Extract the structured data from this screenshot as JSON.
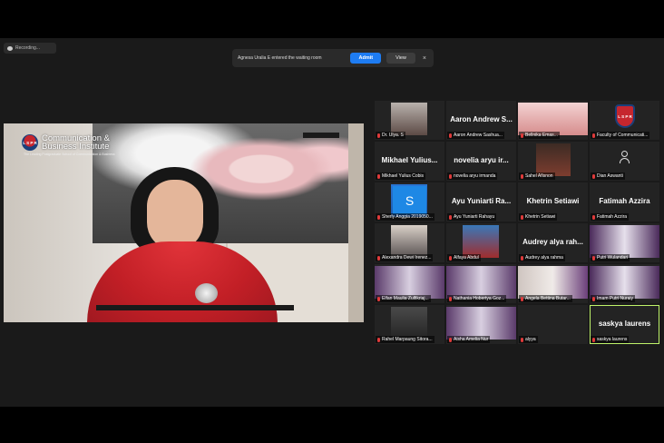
{
  "recording": {
    "label": "Recording..."
  },
  "notification": {
    "message": "Agnesa Uralia E entered the waiting room",
    "admit_label": "Admit",
    "view_label": "View",
    "close_glyph": "×"
  },
  "main_video": {
    "logo_badge": "L S P R",
    "logo_line1": "Communication &",
    "logo_line2": "Business Institute",
    "logo_tagline": "The Leading Postgraduate School of Communication & Business"
  },
  "participants": [
    {
      "name": "Dr. Ulya. S",
      "display": "",
      "style": "s1"
    },
    {
      "name": "Aaron Andrew Sashua...",
      "display": "Aaron Andrew S...",
      "style": ""
    },
    {
      "name": "Bellnika Emas...",
      "display": "",
      "style": "s2"
    },
    {
      "name": "Faculty of Communicati...",
      "display": "",
      "style": "badge"
    },
    {
      "name": "Mikhael Yulius Cobis",
      "display": "Mikhael Yulius...",
      "style": ""
    },
    {
      "name": "novelia aryu irmanda",
      "display": "novelia aryu ir...",
      "style": ""
    },
    {
      "name": "Sahel Afisnon",
      "display": "",
      "style": "s3"
    },
    {
      "name": "Dian Aswanti",
      "display": "",
      "style": "person"
    },
    {
      "name": "Sherly Anggia 2019050...",
      "display": "",
      "style": "s4"
    },
    {
      "name": "Ayu Yuniarti Rahayu",
      "display": "Ayu Yuniarti Ra...",
      "style": ""
    },
    {
      "name": "Khetrin Setiawi",
      "display": "Khetrin Setiawi",
      "style": ""
    },
    {
      "name": "Fatimah Azzira",
      "display": "Fatimah Azzira",
      "style": ""
    },
    {
      "name": "Alexandra Dewi Irenez...",
      "display": "",
      "style": "s5"
    },
    {
      "name": "Alfaya Abdul",
      "display": "",
      "style": "s6"
    },
    {
      "name": "Audrey alya rahma",
      "display": "Audrey alya rah...",
      "style": ""
    },
    {
      "name": "Putri Wulandari",
      "display": "",
      "style": "s7"
    },
    {
      "name": "Elfan Maulia Zulfikriaj...",
      "display": "",
      "style": "s8"
    },
    {
      "name": "Nathania Hobertya Goz...",
      "display": "",
      "style": "s8"
    },
    {
      "name": "Angela Bettina Butar...",
      "display": "",
      "style": "s9"
    },
    {
      "name": "Imam Putri Nuraiy",
      "display": "",
      "style": "s7"
    },
    {
      "name": "Rahel Marpaung Sitora...",
      "display": "",
      "style": "s10"
    },
    {
      "name": "Aisha Amelia Nur",
      "display": "",
      "style": "s8"
    },
    {
      "name": "alyya",
      "display": "",
      "style": "share"
    },
    {
      "name": "saskya laurens",
      "display": "saskya laurens",
      "style": "active"
    }
  ],
  "colors": {
    "accent": "#1e7cf2",
    "active_speaker": "#bff36a",
    "muted_mic": "#e03a3a"
  }
}
